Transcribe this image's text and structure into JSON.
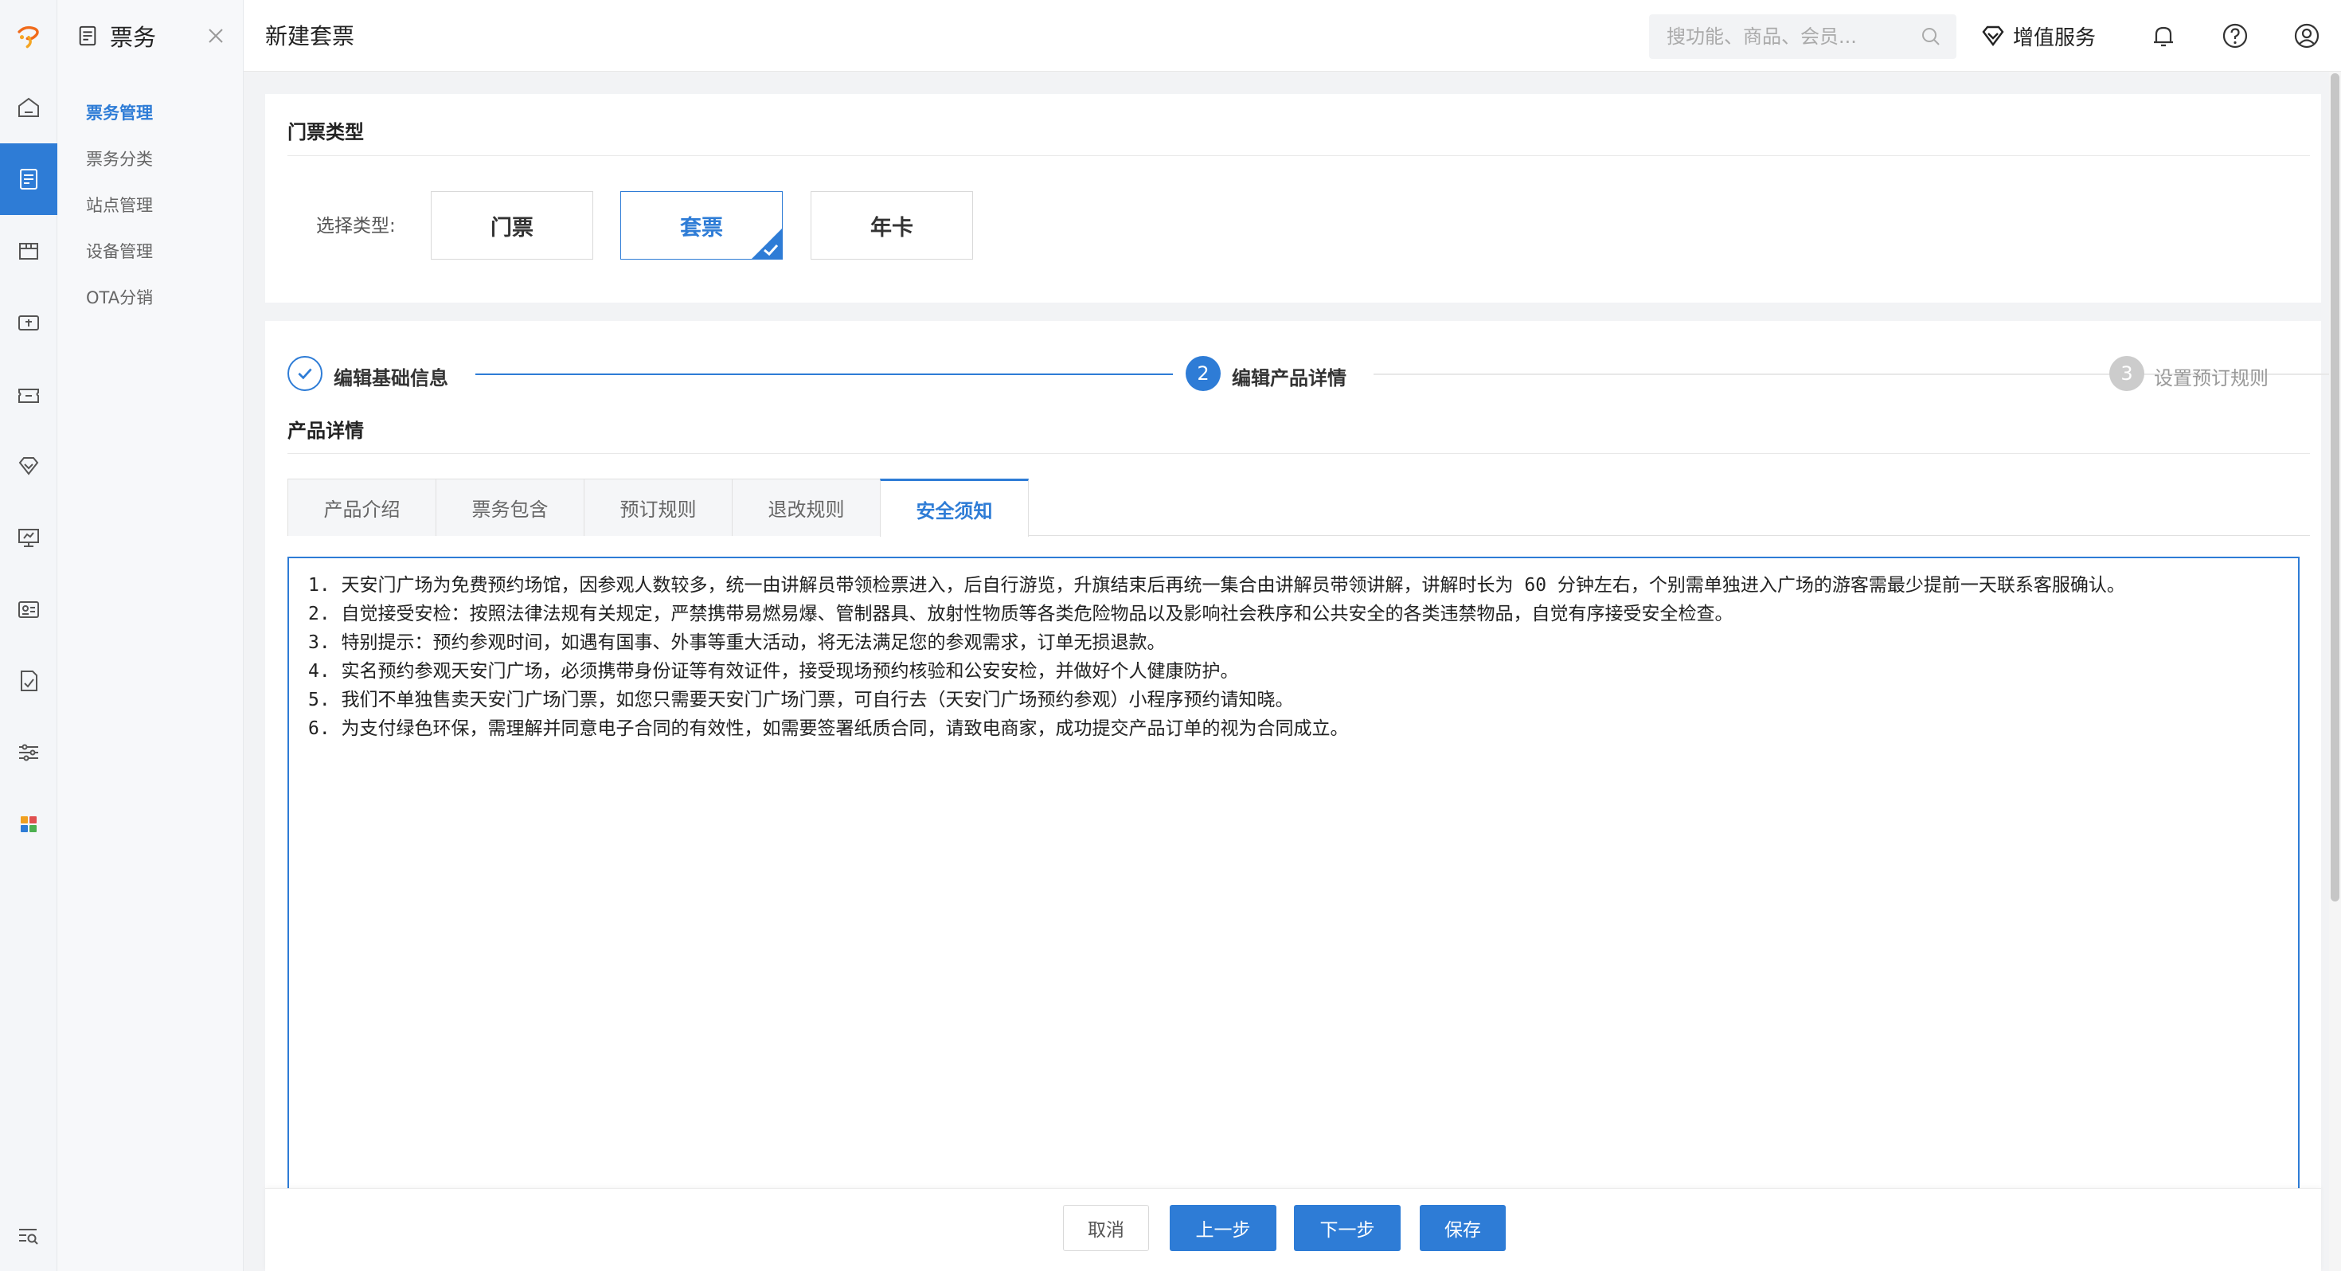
{
  "sidebar": {
    "title": "票务",
    "items": [
      {
        "label": "票务管理",
        "active": true
      },
      {
        "label": "票务分类"
      },
      {
        "label": "站点管理"
      },
      {
        "label": "设备管理"
      },
      {
        "label": "OTA分销"
      }
    ]
  },
  "header": {
    "title": "新建套票",
    "search_placeholder": "搜功能、商品、会员...",
    "value_added": "增值服务"
  },
  "ticket_type": {
    "section_title": "门票类型",
    "label": "选择类型:",
    "options": [
      "门票",
      "套票",
      "年卡"
    ],
    "selected": "套票"
  },
  "steps": [
    {
      "label": "编辑基础信息",
      "state": "done"
    },
    {
      "label": "编辑产品详情",
      "state": "active",
      "num": "2"
    },
    {
      "label": "设置预订规则",
      "state": "pending",
      "num": "3"
    }
  ],
  "detail": {
    "section_title": "产品详情",
    "tabs": [
      "产品介绍",
      "票务包含",
      "预订规则",
      "退改规则",
      "安全须知"
    ],
    "active_tab": "安全须知",
    "content": [
      "1. 天安门广场为免费预约场馆，因参观人数较多，统一由讲解员带领检票进入，后自行游览，升旗结束后再统一集合由讲解员带领讲解，讲解时长为 60 分钟左右，个别需单独进入广场的游客需最少提前一天联系客服确认。",
      "2. 自觉接受安检：按照法律法规有关规定，严禁携带易燃易爆、管制器具、放射性物质等各类危险物品以及影响社会秩序和公共安全的各类违禁物品，自觉有序接受安全检查。",
      "3. 特别提示：预约参观时间，如遇有国事、外事等重大活动，将无法满足您的参观需求，订单无损退款。",
      "4. 实名预约参观天安门广场，必须携带身份证等有效证件，接受现场预约核验和公安安检，并做好个人健康防护。",
      "5. 我们不单独售卖天安门广场门票，如您只需要天安门广场门票，可自行去（天安门广场预约参观）小程序预约请知晓。",
      "6. 为支付绿色环保，需理解并同意电子合同的有效性，如需要签署纸质合同，请致电商家，成功提交产品订单的视为合同成立。"
    ]
  },
  "footer": {
    "cancel": "取消",
    "prev": "上一步",
    "next": "下一步",
    "save": "保存"
  },
  "colors": {
    "accent": "#2e7cd6",
    "pending": "#cccccc"
  }
}
